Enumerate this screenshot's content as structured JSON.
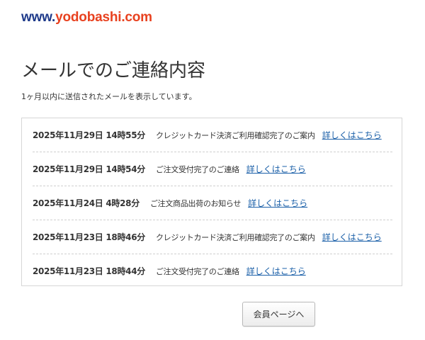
{
  "logo": {
    "prefix": "www.",
    "name": "yodobashi.com",
    "prefix_color": "#1e3a8a",
    "name_color": "#e8411f"
  },
  "page": {
    "title": "メールでのご連絡内容",
    "subtitle": "1ヶ月以内に送信されたメールを表示しています。"
  },
  "mails": [
    {
      "date": "2025年11月29日 14時55分",
      "subject": "クレジットカード決済ご利用確認完了のご案内",
      "link": "詳しくはこちら"
    },
    {
      "date": "2025年11月29日 14時54分",
      "subject": "ご注文受付完了のご連絡",
      "link": "詳しくはこちら"
    },
    {
      "date": "2025年11月24日 4時28分",
      "subject": "ご注文商品出荷のお知らせ",
      "link": "詳しくはこちら"
    },
    {
      "date": "2025年11月23日 18時46分",
      "subject": "クレジットカード決済ご利用確認完了のご案内",
      "link": "詳しくはこちら"
    },
    {
      "date": "2025年11月23日 18時44分",
      "subject": "ご注文受付完了のご連絡",
      "link": "詳しくはこちら"
    }
  ],
  "buttons": {
    "member_page": "会員ページへ"
  },
  "colors": {
    "link": "#1a5fa8",
    "border": "#d6d6d6"
  }
}
